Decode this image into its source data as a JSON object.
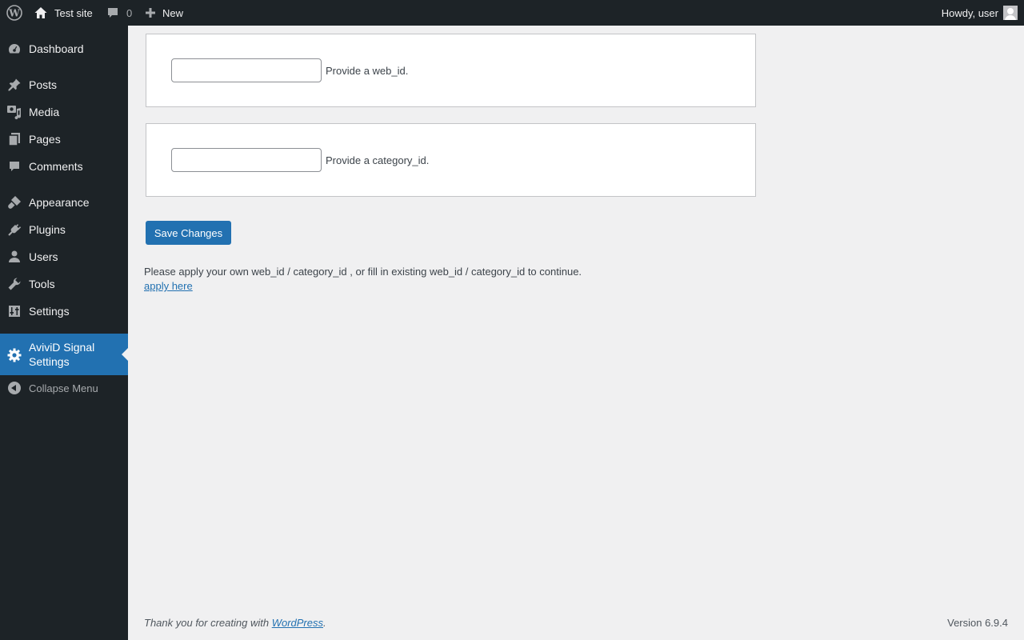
{
  "admin_bar": {
    "site_name": "Test site",
    "comments_count": "0",
    "new_label": "New",
    "howdy": "Howdy, user"
  },
  "sidebar": {
    "items": [
      {
        "label": "Dashboard",
        "icon": "dashboard-icon"
      },
      {
        "label": "Posts",
        "icon": "pin-icon"
      },
      {
        "label": "Media",
        "icon": "media-icon"
      },
      {
        "label": "Pages",
        "icon": "pages-icon"
      },
      {
        "label": "Comments",
        "icon": "comment-icon"
      },
      {
        "label": "Appearance",
        "icon": "brush-icon"
      },
      {
        "label": "Plugins",
        "icon": "plug-icon"
      },
      {
        "label": "Users",
        "icon": "user-icon"
      },
      {
        "label": "Tools",
        "icon": "wrench-icon"
      },
      {
        "label": "Settings",
        "icon": "sliders-icon"
      },
      {
        "label": "AviviD Signal Settings",
        "icon": "gear-icon",
        "current": true
      }
    ],
    "collapse_label": "Collapse Menu"
  },
  "form": {
    "web_id": {
      "value": "",
      "description": "Provide a web_id."
    },
    "category_id": {
      "value": "",
      "description": "Provide a category_id."
    },
    "save_label": "Save Changes"
  },
  "notice": {
    "text": "Please apply your own web_id / category_id , or fill in existing web_id / category_id to continue.",
    "link_label": "apply here"
  },
  "footer": {
    "thanks_prefix": "Thank you for creating with ",
    "wordpress_link": "WordPress",
    "thanks_suffix": ".",
    "version": "Version 6.9.4"
  },
  "colors": {
    "admin_bar_bg": "#1d2327",
    "accent": "#2271b1",
    "page_bg": "#f0f0f1"
  }
}
